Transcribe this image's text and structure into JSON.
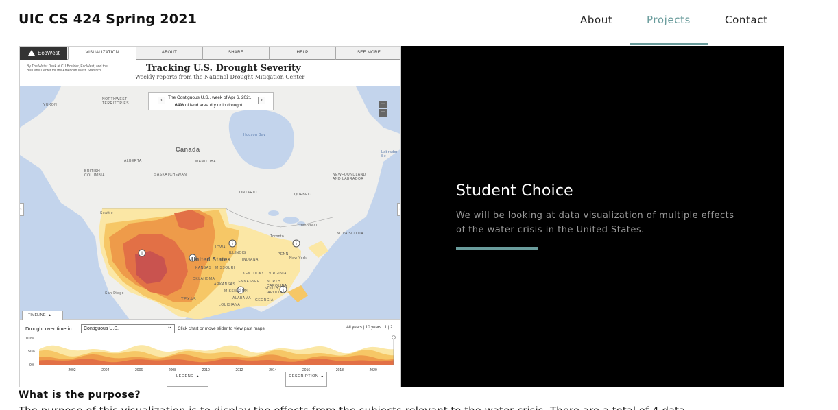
{
  "brand": "UIC CS 424 Spring 2021",
  "nav": {
    "about": "About",
    "projects": "Projects",
    "contact": "Contact"
  },
  "embed": {
    "logo": "EcoWest",
    "tabs": [
      "VISUALIZATION",
      "ABOUT",
      "SHARE",
      "HELP",
      "SEE MORE"
    ],
    "credit": "By The Water Desk at CU Boulder, EcoWest, and the Bill Lane Center for the American West, Stanford",
    "title": "Tracking U.S. Drought Severity",
    "subtitle": "Weekly reports from the National Drought Mitigation Center",
    "week_line1": "The Contiguous U.S., week of Apr 6, 2021",
    "week_pct": "64%",
    "week_line2_rest": "of land area dry or in drought",
    "prev_arrow": "‹",
    "next_arrow": "›",
    "zoom_in": "+",
    "zoom_out": "−",
    "map_labels": {
      "canada": "Canada",
      "hudson_bay": "Hudson Bay",
      "yukon": "YUKON",
      "nwt": "NORTHWEST TERRITORIES",
      "alberta": "ALBERTA",
      "bc": "BRITISH COLUMBIA",
      "saskatchewan": "SASKATCHEWAN",
      "manitoba": "MANITOBA",
      "ontario": "ONTARIO",
      "quebec": "QUEBEC",
      "newfoundland": "NEWFOUNDLAND AND LABRADOR",
      "united_states": "United States",
      "labrador_sea": "Labrador Se",
      "seattle": "Seattle",
      "montreal": "Montreal",
      "toronto": "Toronto",
      "new_york": "New York",
      "north_carolina": "NORTH CAROLINA",
      "san_diego": "San Diego",
      "missouri": "MISSOURI",
      "kansas": "KANSAS",
      "texas": "TEXAS",
      "oklahoma": "OKLAHOMA",
      "arkansas": "ARKANSAS",
      "tennessee": "TENNESSEE",
      "virginia": "VIRGINIA",
      "south_carolina": "SOUTH CAROLINA",
      "alabama": "ALABAMA",
      "georgia": "GEORGIA",
      "louisiana": "LOUISIANA",
      "iowa": "IOWA",
      "illinois": "ILLINOIS",
      "indiana": "INDIANA",
      "kentucky": "KENTUCKY",
      "penn": "PENN",
      "new_hampshire": "NEW HAMPSHIRE",
      "mississippi": "MISSISSIPPI",
      "nova_scotia": "NOVA SCOTIA"
    },
    "timeline": {
      "tab": "TIMELINE",
      "label": "Drought over time in",
      "selected_region": "Contiguous U.S.",
      "hint": "Click chart or move slider to view past maps",
      "years_toggle": "All years | 10 years | 1 | 2",
      "y_ticks": [
        "100%",
        "50%",
        "0%"
      ],
      "x_ticks": [
        "2002",
        "2004",
        "2006",
        "2008",
        "2010",
        "2012",
        "2014",
        "2016",
        "2018",
        "2020"
      ],
      "legend_tab": "LEGEND",
      "description_tab": "DESCRIPTION"
    },
    "colors": {
      "d0": "#fbe7a5",
      "d1": "#f6c766",
      "d2": "#ee9b4a",
      "d3": "#e27046",
      "d4": "#c9534f",
      "water": "#c3d4ec",
      "land": "#efefed"
    }
  },
  "feature": {
    "title": "Student Choice",
    "description": "We will be looking at data visualization of multiple effects of the water crisis in the United States.",
    "accent": "#6a9c9c"
  },
  "purpose": {
    "heading": "What is the purpose?",
    "text": "The purpose of this visualization is to display the effects from the subjects relevant to the water crisis. There are a total of 4 data"
  }
}
